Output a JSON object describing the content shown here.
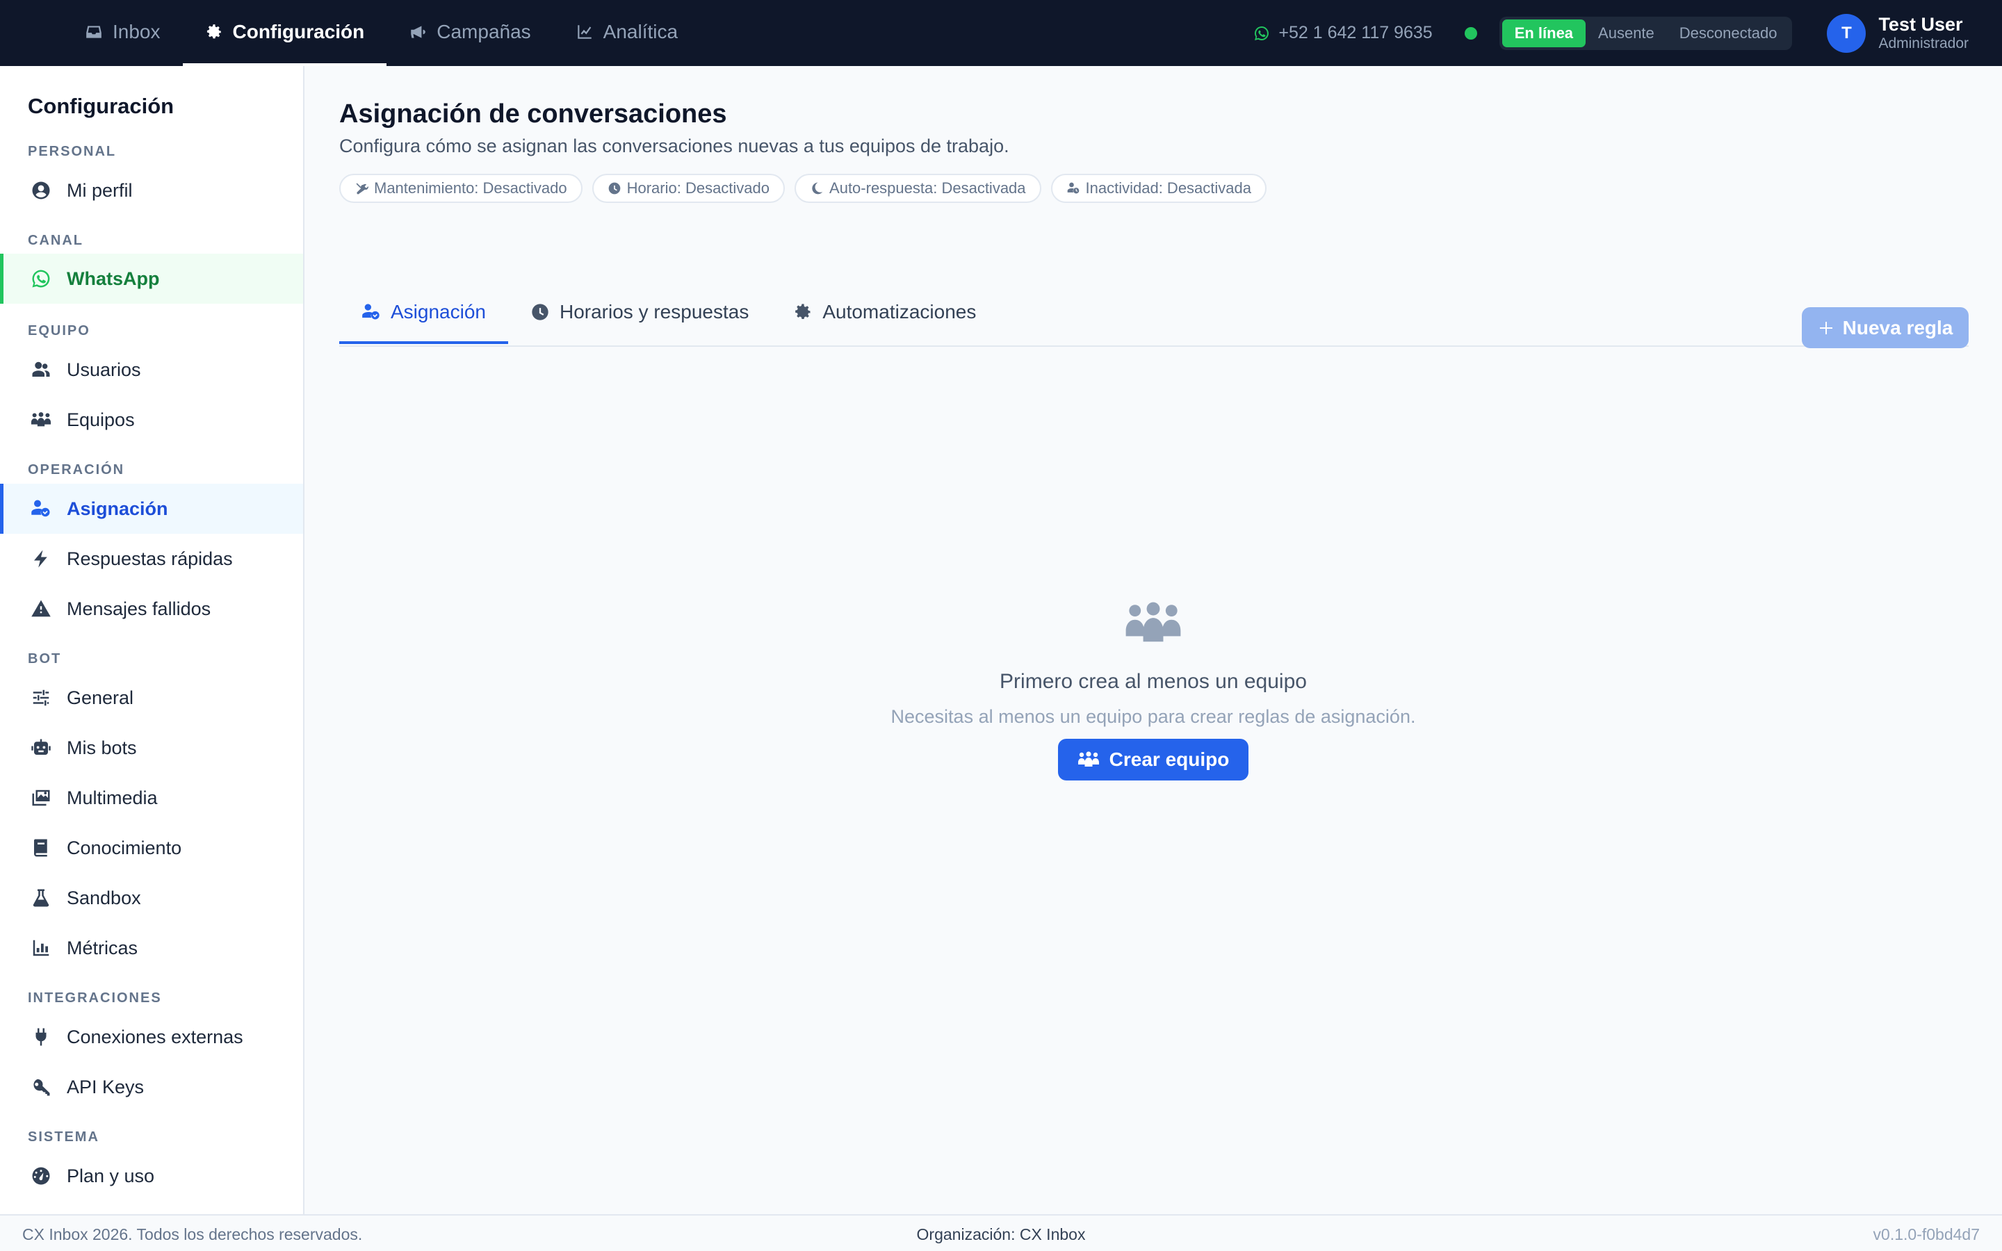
{
  "nav": {
    "items": [
      {
        "label": "Inbox",
        "icon": "inbox-icon"
      },
      {
        "label": "Configuración",
        "icon": "gear-icon"
      },
      {
        "label": "Campañas",
        "icon": "megaphone-icon"
      },
      {
        "label": "Analítica",
        "icon": "chart-line-icon"
      }
    ],
    "active": "Configuración"
  },
  "topbar": {
    "phone": "+52 1 642 117 9635",
    "status": {
      "online": "En línea",
      "away": "Ausente",
      "offline": "Desconectado",
      "selected": "En línea"
    },
    "user": {
      "initial": "T",
      "name": "Test User",
      "role": "Administrador"
    }
  },
  "sidebar": {
    "title": "Configuración",
    "sections": {
      "personal": "PERSONAL",
      "canal": "CANAL",
      "equipo": "EQUIPO",
      "operacion": "OPERACIÓN",
      "bot": "BOT",
      "integraciones": "INTEGRACIONES",
      "sistema": "SISTEMA"
    },
    "items": {
      "mi_perfil": "Mi perfil",
      "whatsapp": "WhatsApp",
      "usuarios": "Usuarios",
      "equipos": "Equipos",
      "asignacion": "Asignación",
      "respuestas": "Respuestas rápidas",
      "mensajes_fallidos": "Mensajes fallidos",
      "general": "General",
      "mis_bots": "Mis bots",
      "multimedia": "Multimedia",
      "conocimiento": "Conocimiento",
      "sandbox": "Sandbox",
      "metricas": "Métricas",
      "conexiones": "Conexiones externas",
      "api_keys": "API Keys",
      "plan": "Plan y uso"
    },
    "active": "Asignación"
  },
  "main": {
    "title": "Asignación de conversaciones",
    "subtitle": "Configura cómo se asignan las conversaciones nuevas a tus equipos de trabajo.",
    "chips": [
      "Mantenimiento: Desactivado",
      "Horario: Desactivado",
      "Auto-respuesta: Desactivada",
      "Inactividad: Desactivada"
    ],
    "tabs": [
      "Asignación",
      "Horarios y respuestas",
      "Automatizaciones"
    ],
    "active_tab": "Asignación",
    "new_rule_label": "Nueva regla",
    "empty": {
      "title": "Primero crea al menos un equipo",
      "subtitle": "Necesitas al menos un equipo para crear reglas de asignación.",
      "button": "Crear equipo"
    }
  },
  "footer": {
    "left": "CX Inbox 2026. Todos los derechos reservados.",
    "center": "Organización: CX Inbox",
    "right": "v0.1.0-f0bd4d7"
  },
  "colors": {
    "topbar": "#0f172a",
    "accent": "#2563eb",
    "online": "#22c55e"
  }
}
